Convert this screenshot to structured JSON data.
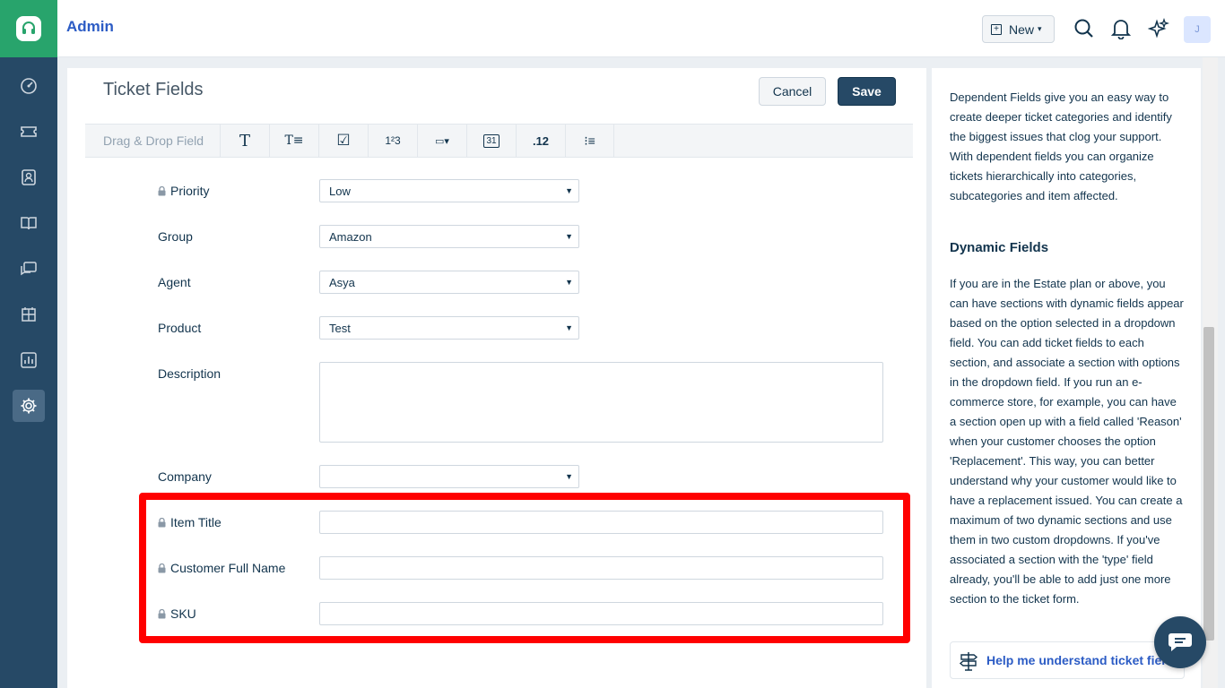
{
  "header": {
    "title": "Admin",
    "new_label": "New",
    "avatar_initial": "J"
  },
  "nav": {
    "items": [
      "dashboard",
      "tickets",
      "contacts",
      "solutions",
      "forums",
      "groups",
      "reports",
      "admin"
    ],
    "active": "admin"
  },
  "page": {
    "title": "Ticket Fields",
    "cancel_label": "Cancel",
    "save_label": "Save"
  },
  "toolbar": {
    "label": "Drag & Drop Field",
    "buttons": [
      {
        "icon": "single-line-text-icon",
        "glyph": "T"
      },
      {
        "icon": "multi-line-text-icon",
        "glyph": "T≡"
      },
      {
        "icon": "checkbox-icon",
        "glyph": "☑"
      },
      {
        "icon": "number-icon",
        "glyph": "1²3"
      },
      {
        "icon": "dropdown-icon",
        "glyph": "▭▾"
      },
      {
        "icon": "date-icon",
        "glyph": "31"
      },
      {
        "icon": "decimal-icon",
        "glyph": ".12"
      },
      {
        "icon": "dependent-field-icon",
        "glyph": "⁝≡"
      }
    ]
  },
  "fields": {
    "priority": {
      "label": "Priority",
      "value": "Low"
    },
    "group": {
      "label": "Group",
      "value": "Amazon"
    },
    "agent": {
      "label": "Agent",
      "value": "Asya"
    },
    "product": {
      "label": "Product",
      "value": "Test"
    },
    "description": {
      "label": "Description"
    },
    "company": {
      "label": "Company",
      "value": ""
    },
    "item_title": {
      "label": "Item Title"
    },
    "customer_full_name": {
      "label": "Customer Full Name"
    },
    "sku": {
      "label": "SKU"
    }
  },
  "help": {
    "dependent_text": "Dependent Fields give you an easy way to create deeper ticket categories and identify the biggest issues that clog your support. With dependent fields you can organize tickets hierarchically into categories, subcategories and item affected.",
    "dynamic_heading": "Dynamic Fields",
    "dynamic_text": "If you are in the Estate plan or above, you can have sections with dynamic fields appear based on the option selected in a dropdown field. You can add ticket fields to each section, and associate a section with options in the dropdown field. If you run an e-commerce store, for example, you can have a section open up with a field called 'Reason' when your customer chooses the option 'Replacement'. This way, you can better understand why your customer would like to have a replacement issued. You can create a maximum of two dynamic sections and use them in two custom dropdowns. If you've associated a section with the 'type' field already, you'll be able to add just one more section to the ticket form.",
    "link_label": "Help me understand ticket fields"
  },
  "colors": {
    "nav_bg": "#264966",
    "brand_green": "#28a46c",
    "highlight_red": "#ff0000",
    "link_blue": "#2c5cc5"
  }
}
